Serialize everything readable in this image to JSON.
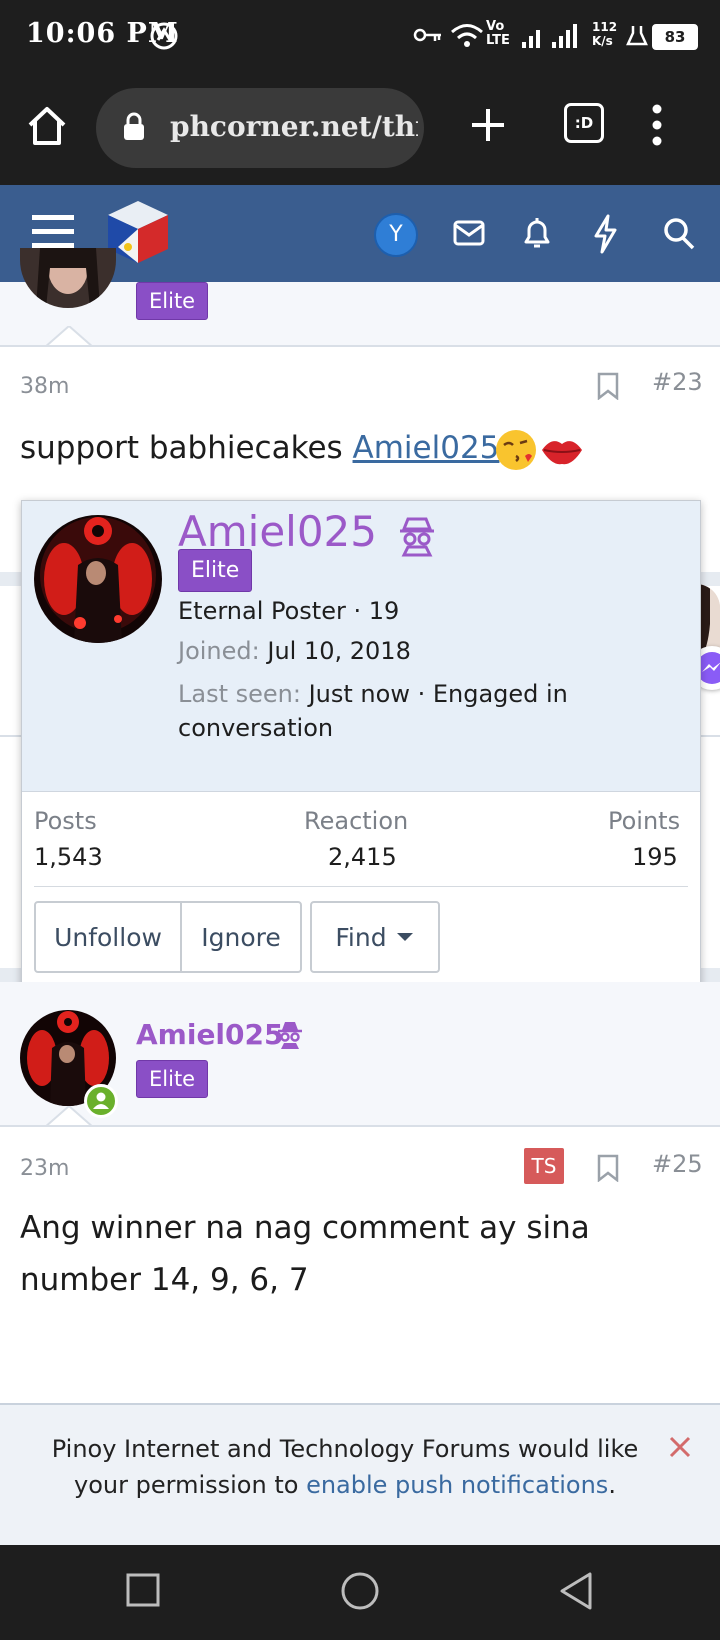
{
  "status_bar": {
    "time": "10:06 PM",
    "network": "Vo LTE",
    "speed": "112 K/s",
    "battery": "83"
  },
  "browser": {
    "url": "phcorner.net/threads",
    "tab_label": ":D"
  },
  "nav": {
    "avatar_letter": "Y"
  },
  "colors": {
    "nav_bg": "#3a5d8f",
    "badge_purple": "#8a4fc6",
    "username_purple": "#9b59c8",
    "link_blue": "#3a6aa0"
  },
  "post_top": {
    "badge": "Elite"
  },
  "post23": {
    "time": "38m",
    "number": "#23",
    "text": "support babhiecakes",
    "mention": "Amiel025"
  },
  "popup": {
    "username": "Amiel025",
    "badge": "Elite",
    "title_line": "Eternal Poster · 19",
    "joined_label": "Joined:",
    "joined_value": "Jul 10, 2018",
    "lastseen_label": "Last seen:",
    "lastseen_value": "Just now · Engaged in",
    "lastseen_value2": "conversation",
    "stats": {
      "posts_label": "Posts",
      "posts_value": "1,543",
      "reaction_label": "Reaction",
      "reaction_value": "2,415",
      "points_label": "Points",
      "points_value": "195"
    },
    "buttons": {
      "unfollow": "Unfollow",
      "ignore": "Ignore",
      "find": "Find"
    }
  },
  "post25_author": {
    "username": "Amiel025",
    "badge": "Elite"
  },
  "post25": {
    "time": "23m",
    "ts_badge": "TS",
    "number": "#25",
    "line1": "Ang winner na nag comment ay sina",
    "line2": "number 14, 9, 6, 7"
  },
  "notification": {
    "text_before": "Pinoy Internet and Technology Forums would like your permission to ",
    "link": "enable push notifications",
    "text_after": "."
  }
}
